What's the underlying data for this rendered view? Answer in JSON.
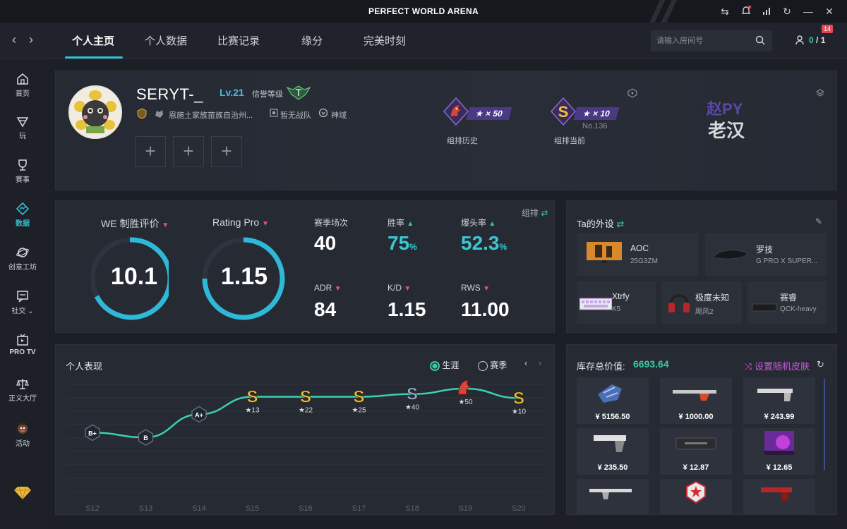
{
  "app": {
    "title": "PERFECT WORLD ARENA"
  },
  "nav": {
    "tabs": [
      "个人主页",
      "个人数据",
      "比赛记录",
      "缘分",
      "完美时刻"
    ],
    "search_placeholder": "请输入房间号",
    "friends_online": "0",
    "friends_total": "1",
    "friends_badge": "14"
  },
  "sidebar": {
    "items": [
      "首页",
      "玩",
      "赛事",
      "数据",
      "创意工坊",
      "社交 ⌄",
      "PRO TV",
      "正义大厅",
      "活动"
    ]
  },
  "profile": {
    "username": "SERYT-_",
    "level": "Lv.21",
    "credit_label": "信誉等级",
    "region": "恩施土家族苗族自治州...",
    "team": "暂无战队",
    "title": "神域",
    "rank_history": {
      "count": "★ × 50",
      "label": "组排历史"
    },
    "rank_current": {
      "count": "★ × 10",
      "number": "No.136",
      "label": "组排当前"
    },
    "signature_line1": "赵PY",
    "signature_line2": "老汉"
  },
  "stats": {
    "mode": "组排",
    "we_label": "WE 制胜评价",
    "we_value": "10.1",
    "rating_label": "Rating Pro",
    "rating_value": "1.15",
    "cells": [
      {
        "label": "赛季场次",
        "value": "40",
        "unit": "",
        "trend": ""
      },
      {
        "label": "胜率",
        "value": "75",
        "unit": "%",
        "trend": "up"
      },
      {
        "label": "爆头率",
        "value": "52.3",
        "unit": "%",
        "trend": "up"
      },
      {
        "label": "ADR",
        "value": "84",
        "unit": "",
        "trend": "down"
      },
      {
        "label": "K/D",
        "value": "1.15",
        "unit": "",
        "trend": "down"
      },
      {
        "label": "RWS",
        "value": "11.00",
        "unit": "",
        "trend": "down"
      }
    ]
  },
  "gear": {
    "title": "Ta的外设",
    "items": [
      {
        "brand": "AOC",
        "model": "25G3ZM"
      },
      {
        "brand": "罗技",
        "model": "G PRO X SUPER..."
      },
      {
        "brand": "Xtrfy",
        "model": "K5"
      },
      {
        "brand": "极度未知",
        "model": "飓风2"
      },
      {
        "brand": "赛睿",
        "model": "QCK-heavy"
      }
    ]
  },
  "performance": {
    "title": "个人表现",
    "radio_career": "生涯",
    "radio_season": "赛季",
    "seasons": [
      "S12",
      "S13",
      "S14",
      "S15",
      "S16",
      "S17",
      "S18",
      "S19",
      "S20"
    ],
    "points": [
      {
        "rank": "B+",
        "stars": ""
      },
      {
        "rank": "B",
        "stars": ""
      },
      {
        "rank": "A+",
        "stars": ""
      },
      {
        "rank": "S",
        "stars": "★13"
      },
      {
        "rank": "S",
        "stars": "★22"
      },
      {
        "rank": "S",
        "stars": "★25"
      },
      {
        "rank": "S",
        "stars": "★40"
      },
      {
        "rank": "",
        "stars": "★50"
      },
      {
        "rank": "S",
        "stars": "★10"
      }
    ],
    "levels": [
      0.35,
      0.28,
      0.62,
      0.88,
      0.88,
      0.88,
      0.92,
      1.0,
      0.86
    ]
  },
  "inventory": {
    "label": "库存总价值:",
    "total": "6693.64",
    "random_skin": "设置随机皮肤",
    "items": [
      "¥ 5156.50",
      "¥ 1000.00",
      "¥ 243.99",
      "¥ 235.50",
      "¥ 12.87",
      "¥ 12.65",
      "",
      "",
      ""
    ]
  },
  "colors": {
    "accent": "#2fc0d2",
    "teal": "#38c9a0",
    "pink": "#e0567b",
    "gold": "#e9b83a"
  }
}
